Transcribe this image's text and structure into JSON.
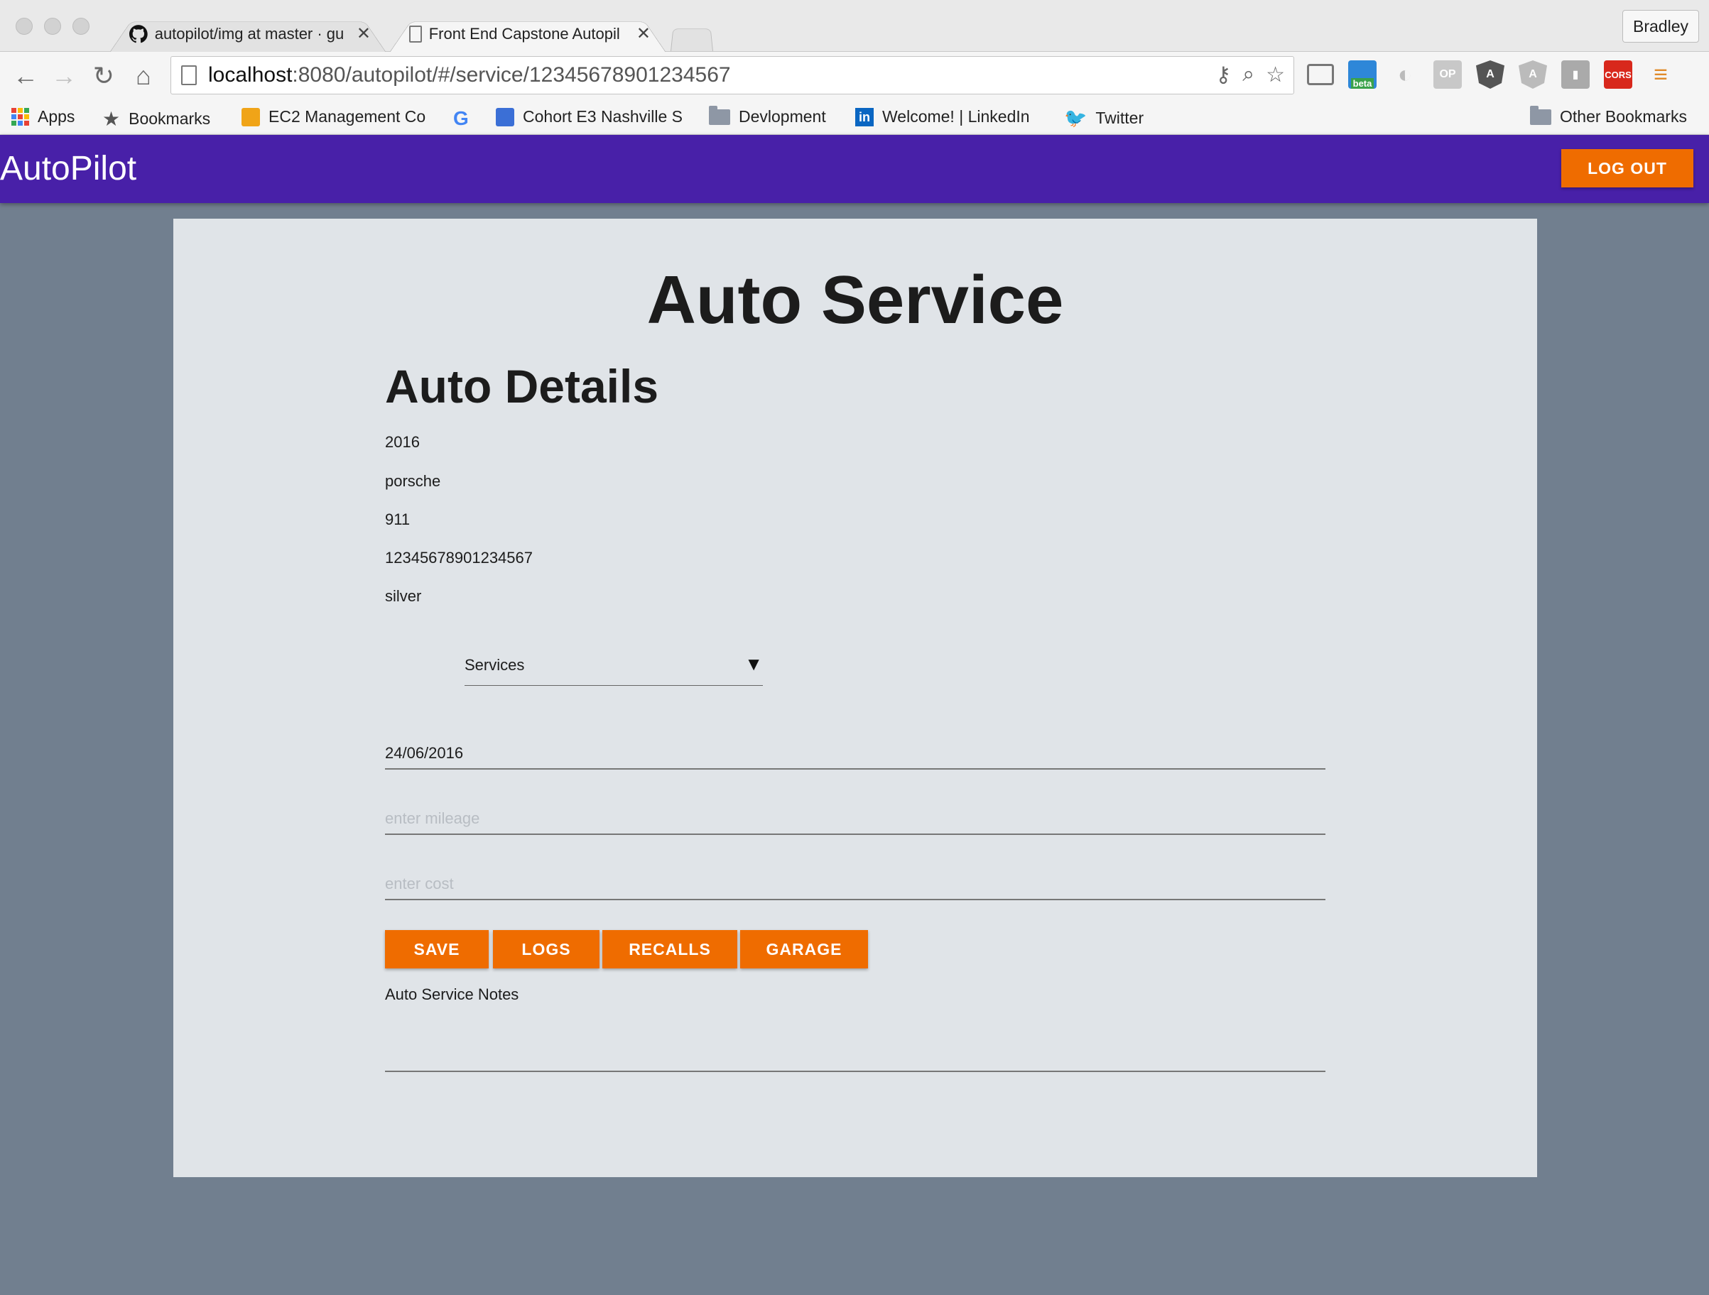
{
  "browser": {
    "tabs": [
      {
        "title": "autopilot/img at master · gu",
        "active": false
      },
      {
        "title": "Front End Capstone Autopil",
        "active": true
      }
    ],
    "profile": "Bradley",
    "url_host": "localhost",
    "url_rest": ":8080/autopilot/#/service/12345678901234567",
    "bookmarks": [
      {
        "label": "Apps",
        "icon": "apps-grid-icon"
      },
      {
        "label": "Bookmarks",
        "icon": "star-icon"
      },
      {
        "label": "EC2 Management Co",
        "icon": "aws-cube-icon"
      },
      {
        "label": "",
        "icon": "google-g-icon"
      },
      {
        "label": "Cohort E3 Nashville S",
        "icon": "calendar-icon"
      },
      {
        "label": "Devlopment",
        "icon": "folder-icon"
      },
      {
        "label": "Welcome! | LinkedIn",
        "icon": "linkedin-icon"
      },
      {
        "label": "Twitter",
        "icon": "twitter-bird-icon"
      }
    ],
    "other_bookmarks": "Other Bookmarks",
    "extensions": {
      "op": "OP",
      "cors": "CORS",
      "beta": "beta"
    }
  },
  "app": {
    "brand": "AutoPilot",
    "logout_label": "LOG OUT",
    "page_title": "Auto Service",
    "details_title": "Auto Details",
    "vehicle": {
      "year": "2016",
      "make": "porsche",
      "model": "911",
      "vin": "12345678901234567",
      "color": "silver"
    },
    "services_select": {
      "selected": "Services"
    },
    "date_value": "24/06/2016",
    "mileage_placeholder": "enter mileage",
    "cost_placeholder": "enter cost",
    "buttons": {
      "save": "SAVE",
      "logs": "LOGS",
      "recalls": "RECALLS",
      "garage": "GARAGE"
    },
    "notes_label": "Auto Service Notes"
  },
  "colors": {
    "appbar": "#4820a8",
    "accent": "#ef6c00",
    "background": "#717f8f",
    "card": "#e0e4e8"
  }
}
